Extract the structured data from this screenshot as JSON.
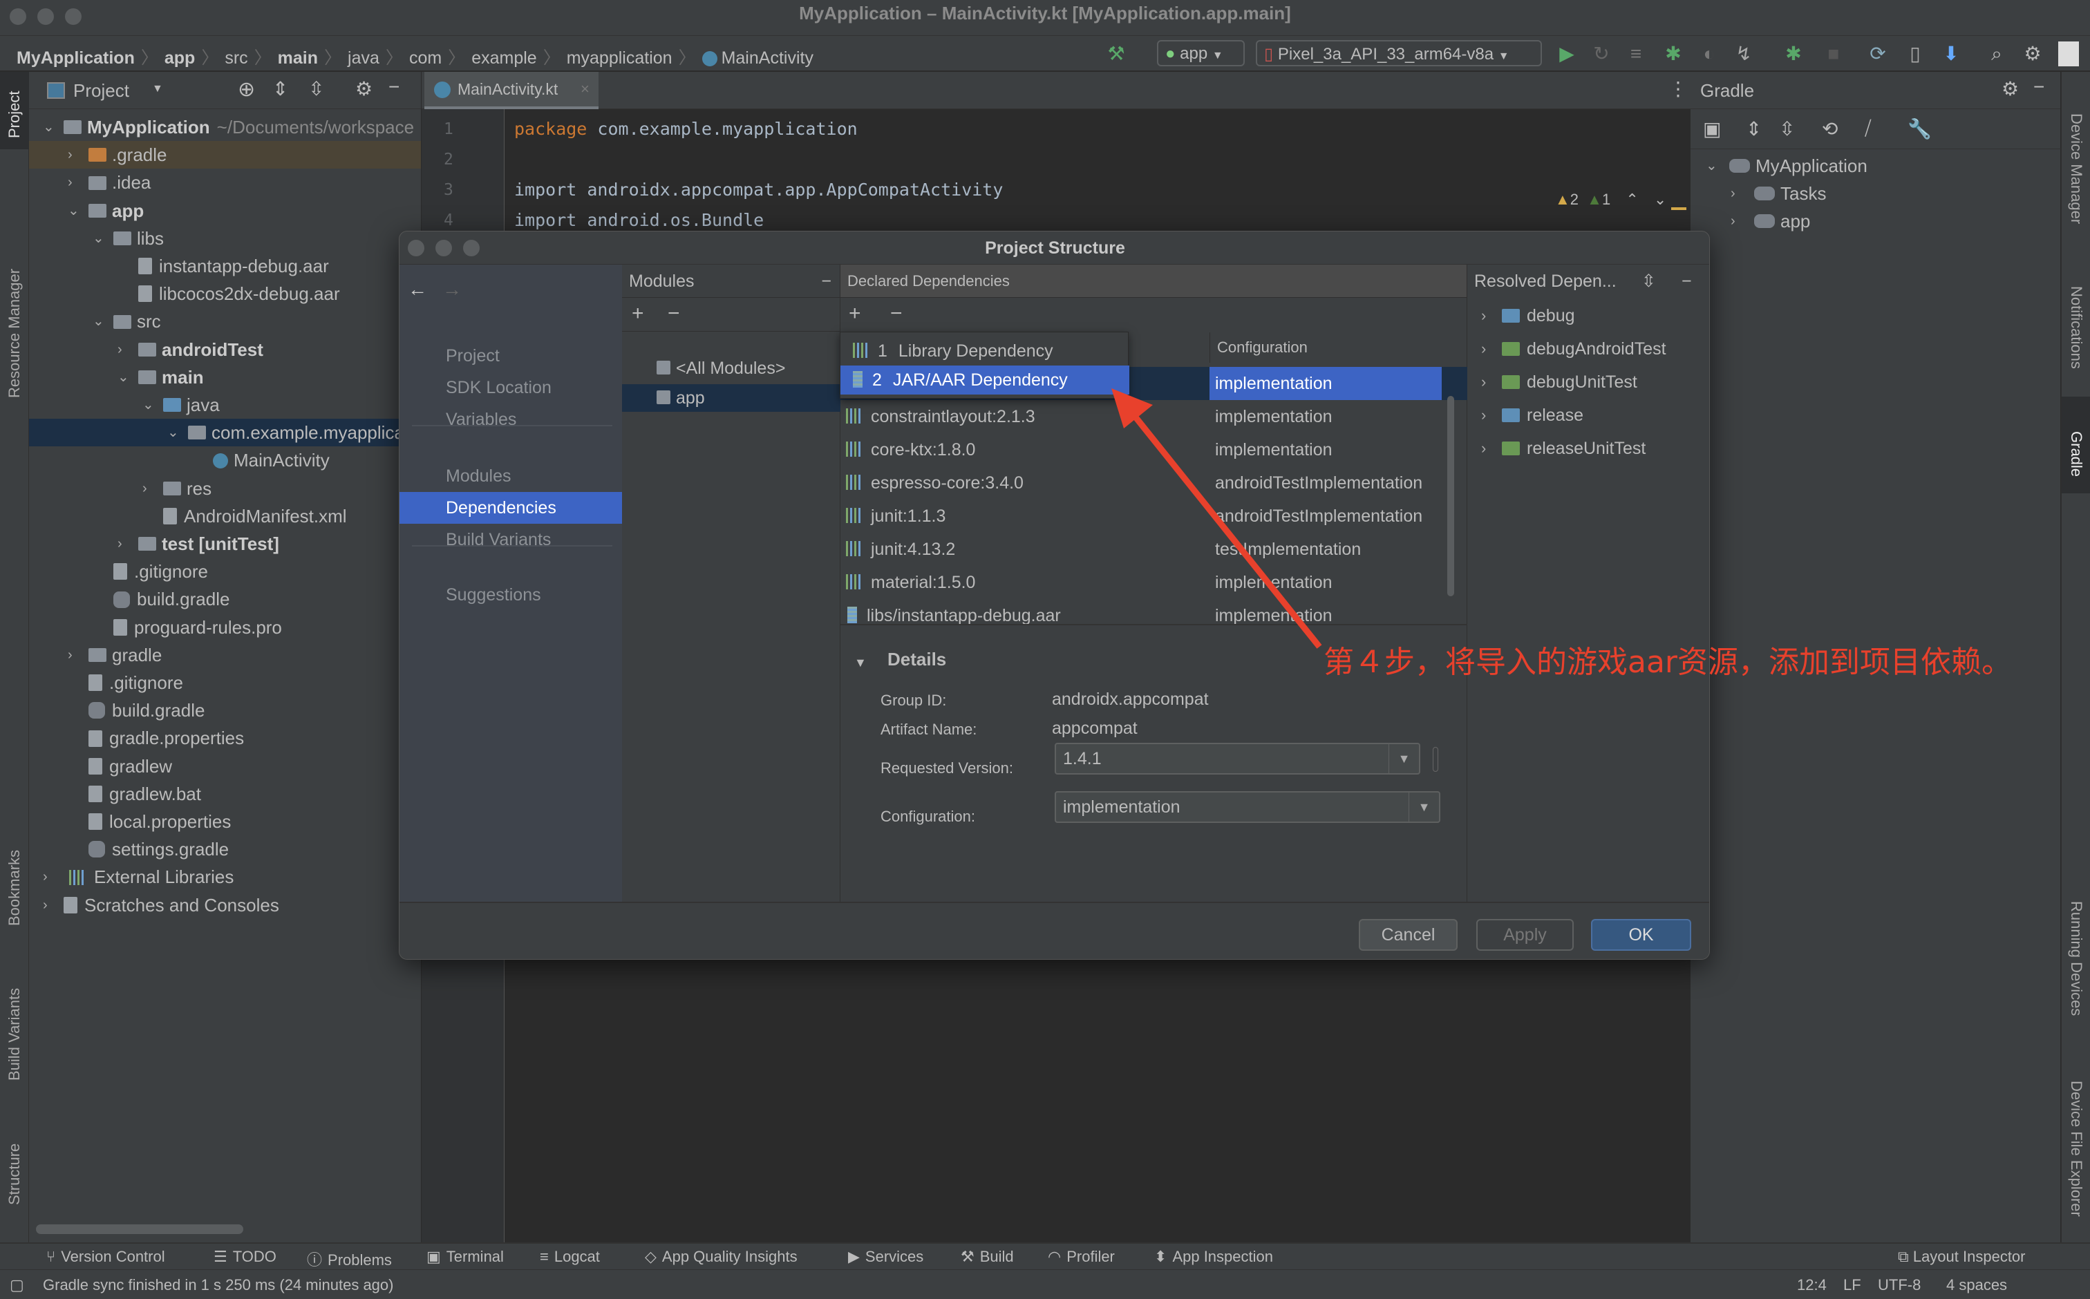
{
  "window": {
    "title": "MyApplication – MainActivity.kt [MyApplication.app.main]"
  },
  "breadcrumb": [
    "MyApplication",
    "app",
    "src",
    "main",
    "java",
    "com",
    "example",
    "myapplication",
    "MainActivity"
  ],
  "toolbar": {
    "run_config": "app",
    "device": "Pixel_3a_API_33_arm64-v8a"
  },
  "left_stripe": {
    "project": "Project",
    "resource_manager": "Resource Manager",
    "bookmarks": "Bookmarks",
    "build_variants": "Build Variants",
    "structure": "Structure"
  },
  "right_stripe": {
    "device_manager": "Device Manager",
    "notifications": "Notifications",
    "gradle": "Gradle",
    "running_devices": "Running Devices",
    "device_file_explorer": "Device File Explorer"
  },
  "project_panel": {
    "title": "Project",
    "tree": [
      {
        "label": "MyApplication",
        "hint": "~/Documents/workspace",
        "level": 0,
        "state": "open",
        "bold": true,
        "type": "module"
      },
      {
        "label": ".gradle",
        "level": 1,
        "state": "closed",
        "type": "folder-orange",
        "highlight": true
      },
      {
        "label": ".idea",
        "level": 1,
        "state": "closed",
        "type": "folder"
      },
      {
        "label": "app",
        "level": 1,
        "state": "open",
        "bold": true,
        "type": "module"
      },
      {
        "label": "libs",
        "level": 2,
        "state": "open",
        "type": "folder"
      },
      {
        "label": "instantapp-debug.aar",
        "level": 3,
        "type": "file"
      },
      {
        "label": "libcocos2dx-debug.aar",
        "level": 3,
        "type": "file"
      },
      {
        "label": "src",
        "level": 2,
        "state": "open",
        "type": "folder"
      },
      {
        "label": "androidTest",
        "level": 3,
        "state": "closed",
        "bold": true,
        "type": "folder"
      },
      {
        "label": "main",
        "level": 3,
        "state": "open",
        "bold": true,
        "type": "folder"
      },
      {
        "label": "java",
        "level": 4,
        "state": "open",
        "type": "folder-blue"
      },
      {
        "label": "com.example.myapplication",
        "level": 5,
        "state": "open",
        "type": "folder",
        "selected": true
      },
      {
        "label": "MainActivity",
        "level": 6,
        "type": "kotlin"
      },
      {
        "label": "res",
        "level": 4,
        "state": "closed",
        "type": "folder"
      },
      {
        "label": "AndroidManifest.xml",
        "level": 4,
        "type": "file"
      },
      {
        "label": "test [unitTest]",
        "level": 3,
        "state": "closed",
        "bold": true,
        "type": "folder"
      },
      {
        "label": ".gitignore",
        "level": 2,
        "type": "file"
      },
      {
        "label": "build.gradle",
        "level": 2,
        "type": "gradle"
      },
      {
        "label": "proguard-rules.pro",
        "level": 2,
        "type": "file"
      },
      {
        "label": "gradle",
        "level": 1,
        "state": "closed",
        "type": "folder"
      },
      {
        "label": ".gitignore",
        "level": 1,
        "type": "file"
      },
      {
        "label": "build.gradle",
        "level": 1,
        "type": "gradle"
      },
      {
        "label": "gradle.properties",
        "level": 1,
        "type": "file"
      },
      {
        "label": "gradlew",
        "level": 1,
        "type": "file"
      },
      {
        "label": "gradlew.bat",
        "level": 1,
        "type": "file"
      },
      {
        "label": "local.properties",
        "level": 1,
        "type": "file"
      },
      {
        "label": "settings.gradle",
        "level": 1,
        "type": "gradle"
      },
      {
        "label": "External Libraries",
        "level": 0,
        "state": "closed",
        "type": "lib"
      },
      {
        "label": "Scratches and Consoles",
        "level": 0,
        "state": "closed",
        "type": "file"
      }
    ]
  },
  "editor": {
    "tab": "MainActivity.kt",
    "lines": [
      {
        "n": "1",
        "kw": "package",
        "text": " com.example.myapplication"
      },
      {
        "n": "2",
        "kw": "",
        "text": ""
      },
      {
        "n": "3",
        "kw": "",
        "text": "import androidx.appcompat.app.AppCompatActivity"
      },
      {
        "n": "4",
        "kw": "",
        "text": "import android.os.Bundle"
      }
    ],
    "warnings": "2",
    "weak_warnings": "1"
  },
  "gradle_panel": {
    "title": "Gradle",
    "tree": [
      {
        "label": "MyApplication",
        "level": 0,
        "state": "open"
      },
      {
        "label": "Tasks",
        "level": 1,
        "state": "closed"
      },
      {
        "label": "app",
        "level": 1,
        "state": "closed"
      }
    ]
  },
  "dialog": {
    "title": "Project Structure",
    "sidebar": [
      {
        "label": "Project"
      },
      {
        "label": "SDK Location"
      },
      {
        "label": "Variables"
      },
      {
        "label": "Modules"
      },
      {
        "label": "Dependencies",
        "selected": true
      },
      {
        "label": "Build Variants"
      },
      {
        "label": "Suggestions"
      }
    ],
    "modules": {
      "title": "Modules",
      "items": [
        "<All Modules>",
        "app"
      ],
      "selected": "app"
    },
    "declared": {
      "title": "Declared Dependencies",
      "config_header": "Configuration",
      "rows": [
        {
          "name": "",
          "config": "implementation",
          "selected": true
        },
        {
          "name": "constraintlayout:2.1.3",
          "config": "implementation",
          "type": "lib"
        },
        {
          "name": "core-ktx:1.8.0",
          "config": "implementation",
          "type": "lib"
        },
        {
          "name": "espresso-core:3.4.0",
          "config": "androidTestImplementation",
          "type": "lib"
        },
        {
          "name": "junit:1.1.3",
          "config": "androidTestImplementation",
          "type": "lib"
        },
        {
          "name": "junit:4.13.2",
          "config": "testImplementation",
          "type": "lib"
        },
        {
          "name": "material:1.5.0",
          "config": "implementation",
          "type": "lib"
        },
        {
          "name": "libs/instantapp-debug.aar",
          "config": "implementation",
          "type": "jar"
        }
      ]
    },
    "add_menu": [
      {
        "num": "1",
        "label": "Library Dependency"
      },
      {
        "num": "2",
        "label": "JAR/AAR Dependency",
        "selected": true
      }
    ],
    "details": {
      "title": "Details",
      "group_id_label": "Group ID:",
      "group_id": "androidx.appcompat",
      "artifact_label": "Artifact Name:",
      "artifact": "appcompat",
      "version_label": "Requested Version:",
      "version": "1.4.1",
      "config_label": "Configuration:",
      "config": "implementation"
    },
    "resolved": {
      "title": "Resolved Depen...",
      "items": [
        "debug",
        "debugAndroidTest",
        "debugUnitTest",
        "release",
        "releaseUnitTest"
      ]
    },
    "buttons": {
      "cancel": "Cancel",
      "apply": "Apply",
      "ok": "OK"
    }
  },
  "annotation": {
    "text": "第４步，将导入的游戏aar资源，添加到项目依赖。",
    "color": "#e8412c"
  },
  "bottom_tools": [
    "Version Control",
    "TODO",
    "Problems",
    "Terminal",
    "Logcat",
    "App Quality Insights",
    "Services",
    "Build",
    "Profiler",
    "App Inspection"
  ],
  "layout_inspector": "Layout Inspector",
  "status": {
    "message": "Gradle sync finished in 1 s 250 ms (24 minutes ago)",
    "position": "12:4",
    "line_sep": "LF",
    "encoding": "UTF-8",
    "indent": "4 spaces"
  },
  "colors": {
    "selection": "#3d64c4",
    "tree_selection": "#1c2f45",
    "accent_green": "#59a869"
  }
}
